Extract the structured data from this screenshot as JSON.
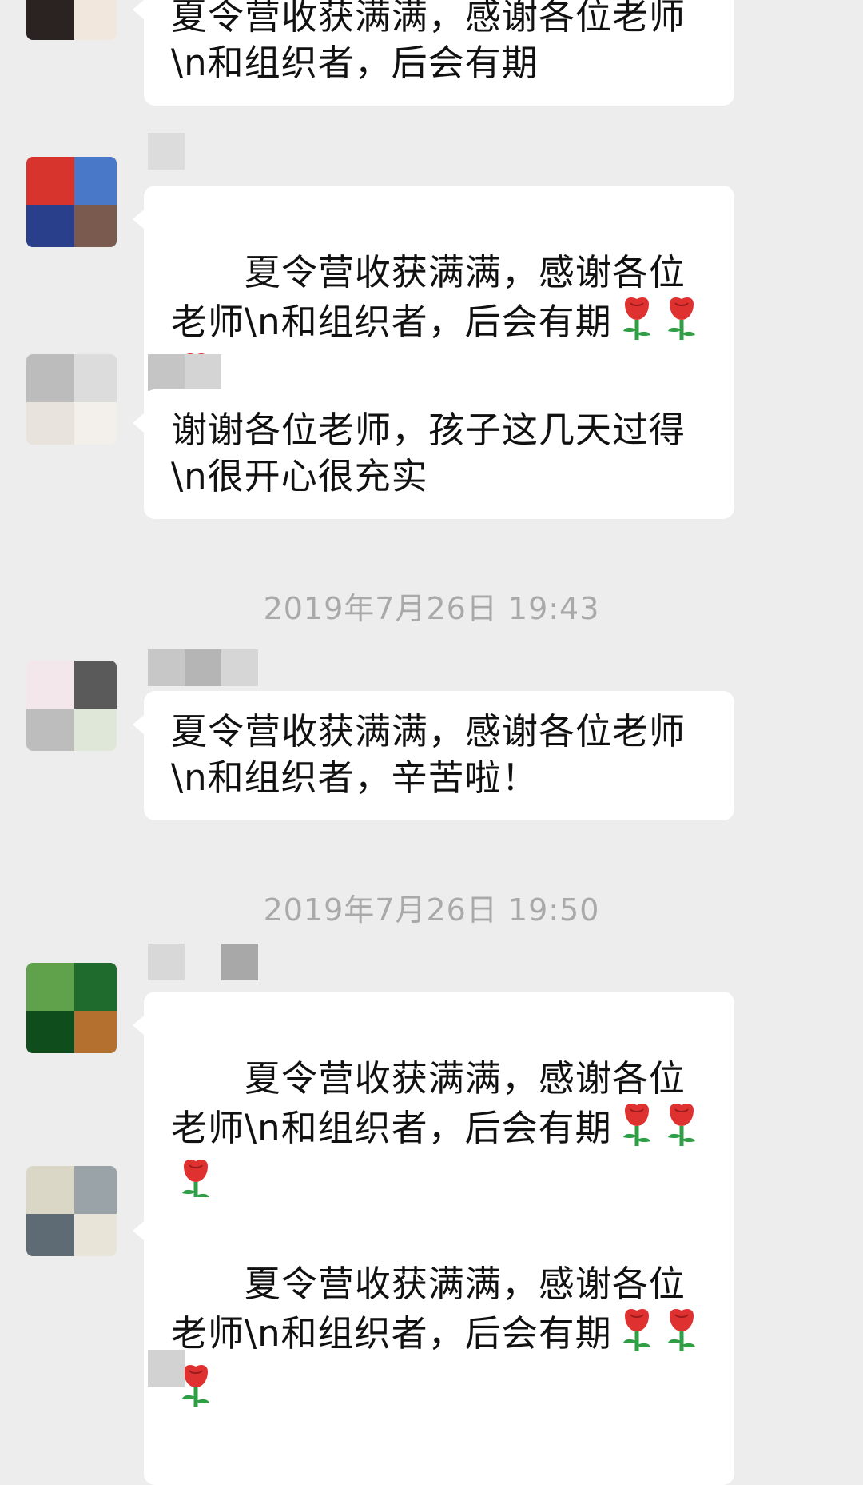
{
  "colors": {
    "background": "#ededed",
    "bubble": "#ffffff",
    "text": "#111111",
    "timestamp": "#a9a9a9"
  },
  "messages": [
    {
      "text": "夏令营收获满满，感谢各位老师\\n和组织者，后会有期",
      "emojis": [],
      "avatar": [
        "#6b4a45",
        "#c7a9a0",
        "#2b2222",
        "#f1e7dc"
      ]
    },
    {
      "text": "夏令营收获满满，感谢各位老师\\n和组织者，后会有期",
      "emojis": [
        "rose-emoji-icon",
        "rose-emoji-icon",
        "rose-emoji-icon"
      ],
      "avatar": [
        "#d6342c",
        "#4a78c9",
        "#2a3f8c",
        "#7a5a4f"
      ]
    },
    {
      "text": "谢谢各位老师，孩子这几天过得\\n很开心很充实",
      "emojis": [],
      "avatar": [
        "#bcbcbc",
        "#dcdcdc",
        "#e9e3dd",
        "#f3f0ec"
      ]
    },
    {
      "text": "夏令营收获满满，感谢各位老师\\n和组织者，辛苦啦！",
      "emojis": [],
      "avatar": [
        "#f3e7ec",
        "#5a5a5a",
        "#bdbdbd",
        "#dfe8d8"
      ]
    },
    {
      "text": "夏令营收获满满，感谢各位老师\\n和组织者，后会有期",
      "emojis": [
        "rose-emoji-icon",
        "rose-emoji-icon",
        "rose-emoji-icon"
      ],
      "avatar": [
        "#5fa24b",
        "#1f6b2d",
        "#0f4d1c",
        "#b3702f"
      ]
    },
    {
      "text": "夏令营收获满满，感谢各位老师\\n和组织者，后会有期",
      "emojis": [
        "rose-emoji-icon",
        "rose-emoji-icon",
        "rose-emoji-icon"
      ],
      "avatar": [
        "#dbd7c7",
        "#9aa3a8",
        "#5e6b74",
        "#e8e4d8"
      ]
    }
  ],
  "timestamps": [
    "2019年7月26日 19:43",
    "2019年7月26日 19:50"
  ]
}
